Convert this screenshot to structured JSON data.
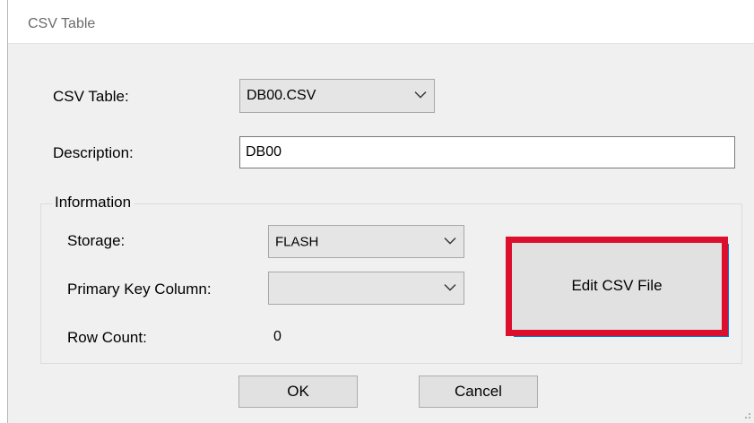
{
  "window": {
    "title": "CSV Table"
  },
  "fields": {
    "csv_table_label": "CSV Table:",
    "csv_table_value": "DB00.CSV",
    "description_label": "Description:",
    "description_value": "DB00"
  },
  "information": {
    "legend": "Information",
    "storage_label": "Storage:",
    "storage_value": "FLASH",
    "primary_key_label": "Primary Key Column:",
    "primary_key_value": "",
    "row_count_label": "Row Count:",
    "row_count_value": "0",
    "edit_button": "Edit CSV File"
  },
  "buttons": {
    "ok": "OK",
    "cancel": "Cancel"
  },
  "colors": {
    "highlight": "#dc0f2e",
    "focus": "#0078d7",
    "dialog_bg": "#f0f0f0"
  },
  "icons": {
    "dropdown": "chevron-down-icon",
    "resize": "resize-grip-icon"
  }
}
